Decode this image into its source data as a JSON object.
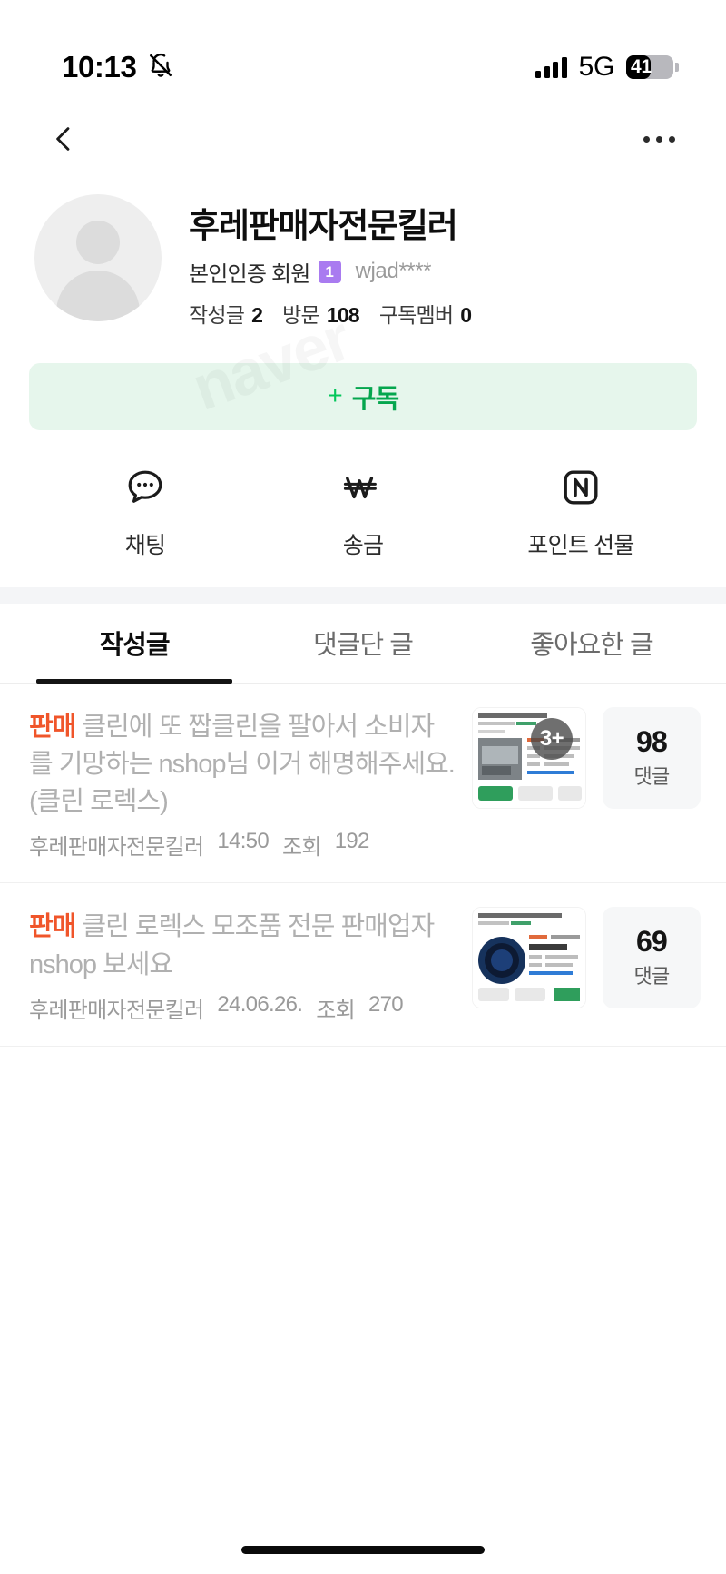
{
  "status_bar": {
    "time": "10:13",
    "mute_icon": "bell-slash-icon",
    "network": "5G",
    "battery_percent": "41",
    "battery_level": 41
  },
  "nav": {
    "back_icon": "chevron-left-icon",
    "more_icon": "more-horizontal-icon"
  },
  "profile": {
    "avatar_icon": "default-avatar-icon",
    "nickname": "후레판매자전문킬러",
    "grade_text": "본인인증 회원",
    "grade_badge": "1",
    "grade_badge_color": "#a97bf0",
    "user_id": "wjad****",
    "stats": [
      {
        "label": "작성글",
        "value": "2"
      },
      {
        "label": "방문",
        "value": "108"
      },
      {
        "label": "구독멤버",
        "value": "0"
      }
    ]
  },
  "subscribe": {
    "plus": "+",
    "label": "구독",
    "accent_color": "#03c75a",
    "background_color": "#e6f6ec"
  },
  "actions": [
    {
      "icon": "chat-bubble-icon",
      "label": "채팅"
    },
    {
      "icon": "won-currency-icon",
      "label": "송금"
    },
    {
      "icon": "naver-point-icon",
      "label": "포인트 선물"
    }
  ],
  "tabs": [
    {
      "label": "작성글",
      "active": true
    },
    {
      "label": "댓글단 글",
      "active": false
    },
    {
      "label": "좋아요한 글",
      "active": false
    }
  ],
  "posts": [
    {
      "tag": "판매",
      "title": "클린에 또 짭클린을 팔아서 소비자를 기망하는 nshop님 이거 해명해주세요.(클린 로렉스)",
      "author": "후레판매자전문킬러",
      "date": "14:50",
      "views_label": "조회",
      "views": "192",
      "thumbnail_badge": "3+",
      "comment_count": "98",
      "comment_label": "댓글"
    },
    {
      "tag": "판매",
      "title": "클린 로렉스 모조품 전문 판매업자 nshop 보세요",
      "author": "후레판매자전문킬러",
      "date": "24.06.26.",
      "views_label": "조회",
      "views": "270",
      "thumbnail_badge": "",
      "comment_count": "69",
      "comment_label": "댓글"
    }
  ],
  "watermark": "naver"
}
